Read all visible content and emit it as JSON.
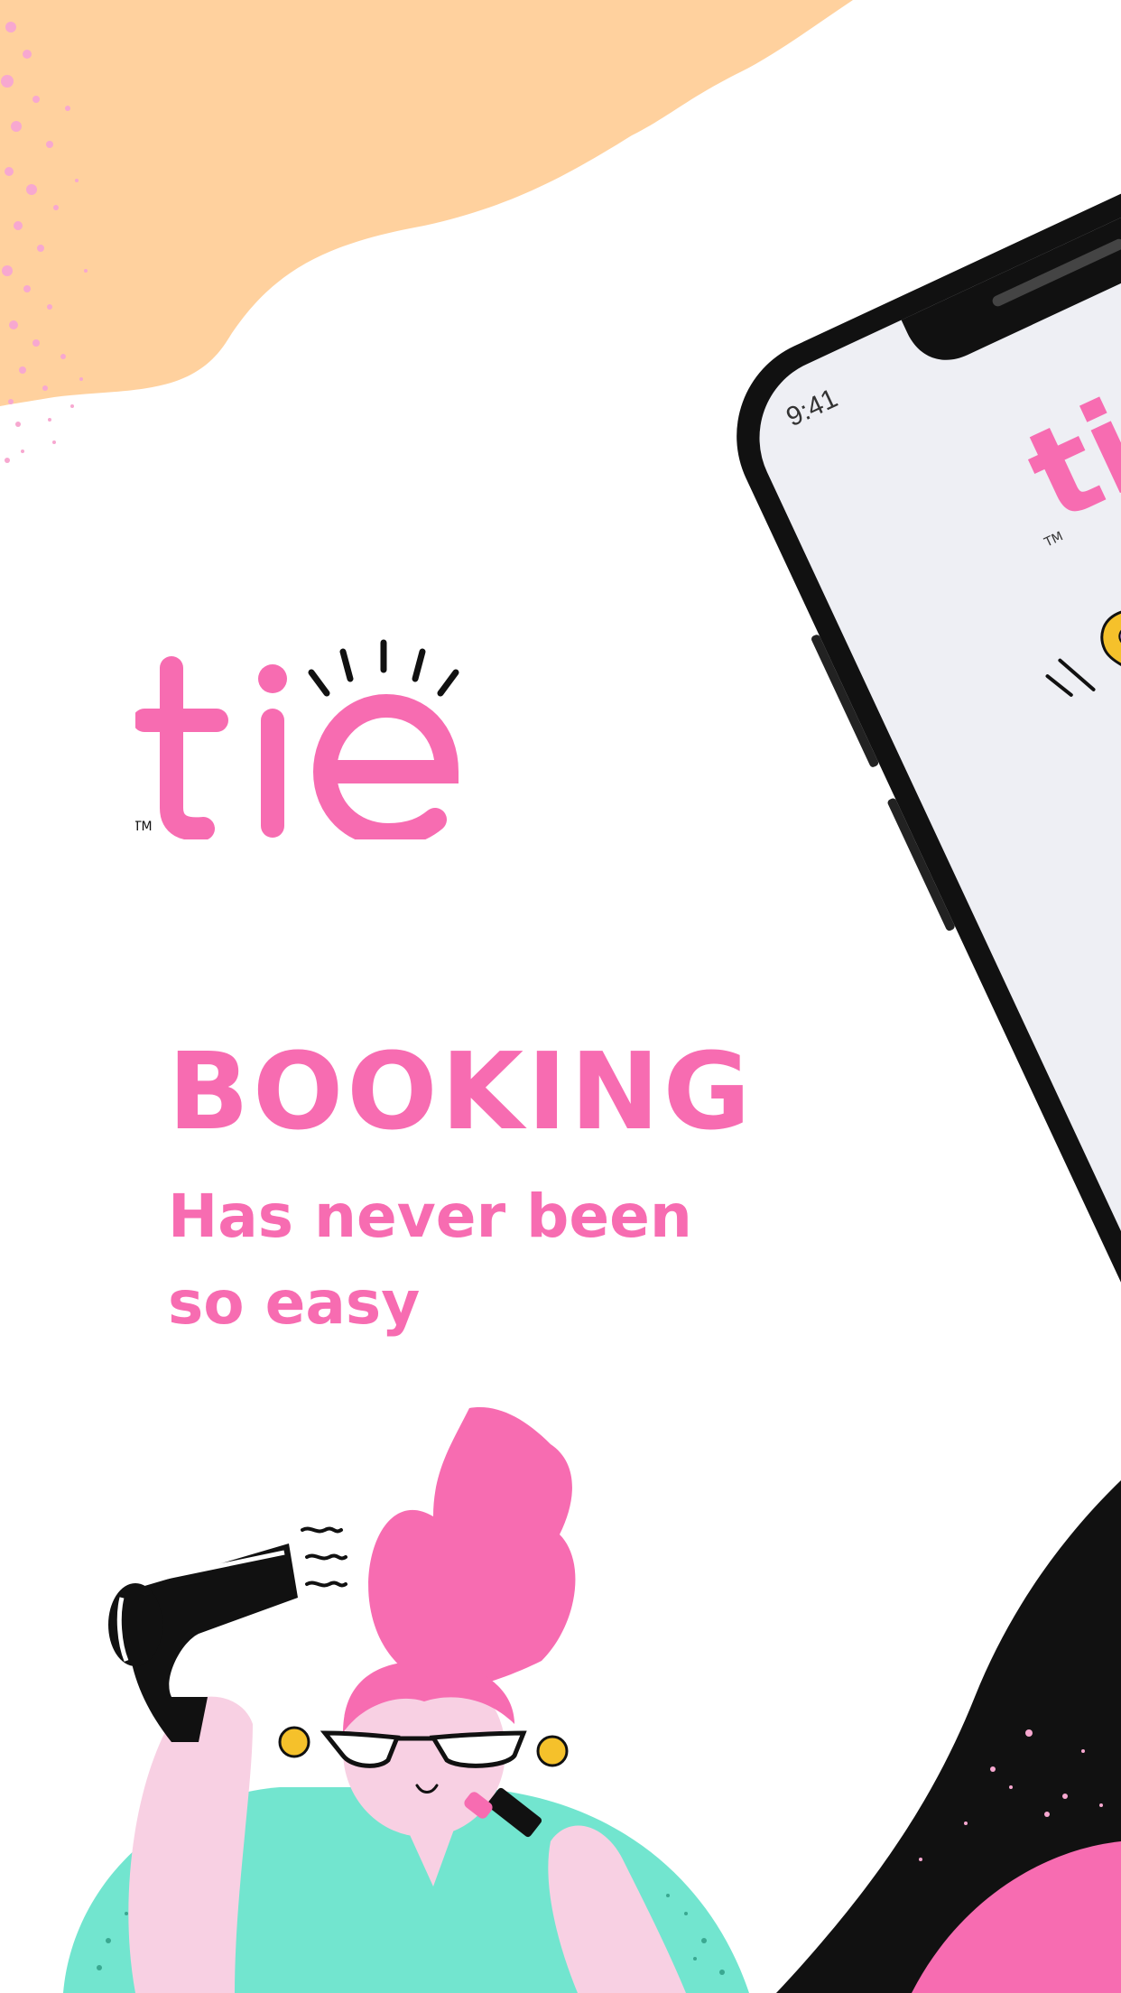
{
  "app": {
    "logo_text": "tie",
    "trademark": "TM"
  },
  "promo": {
    "headline": "BOOKING",
    "subline_1": "Has never been",
    "subline_2": "so easy"
  },
  "phone": {
    "status_time": "9:41",
    "logo_text": "ti",
    "trademark": "TM"
  },
  "colors": {
    "brand_pink": "#f76cb1",
    "peach": "#ffd19e",
    "mint": "#72e5cf",
    "skin": "#f8d0e3",
    "screen_bg": "#eeeff4",
    "phone_frame": "#111111"
  }
}
